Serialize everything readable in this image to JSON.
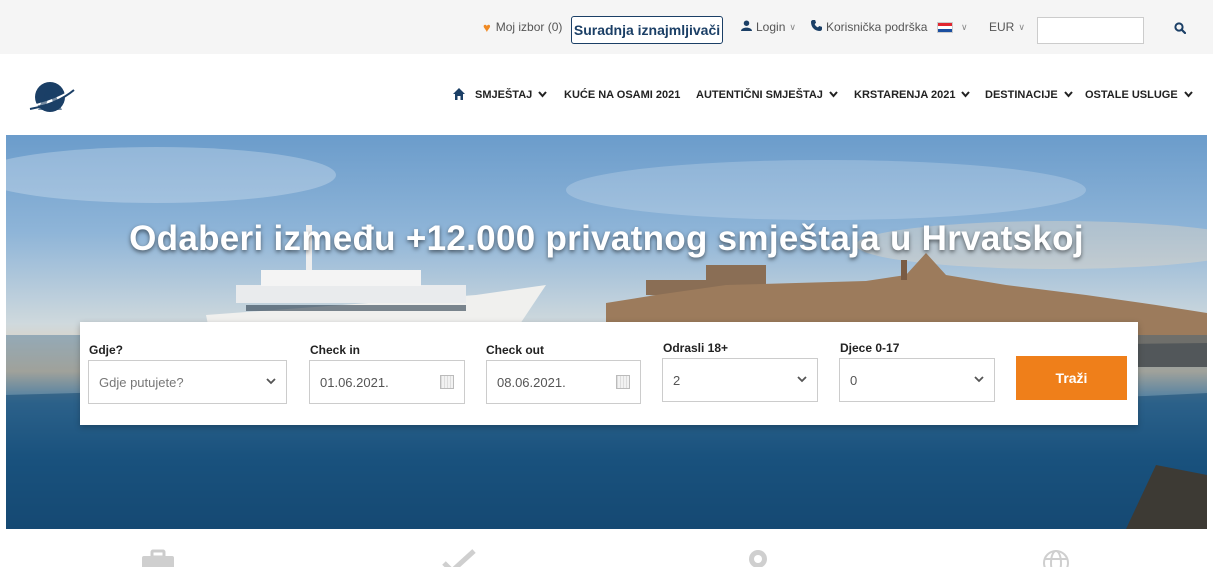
{
  "topbar": {
    "favorites_label": "Moj izbor (0)",
    "partner_label": "Suradnja iznajmljivači",
    "login_label": "Login",
    "support_label": "Korisnička podrška",
    "currency_label": "EUR",
    "search_placeholder": ""
  },
  "nav": {
    "items": [
      {
        "label": "SMJEŠTAJ",
        "dropdown": true
      },
      {
        "label": "KUĆE NA OSAMI 2021",
        "dropdown": false
      },
      {
        "label": "AUTENTIČNI SMJEŠTAJ",
        "dropdown": true
      },
      {
        "label": "KRSTARENJA 2021",
        "dropdown": true
      },
      {
        "label": "DESTINACIJE",
        "dropdown": true
      },
      {
        "label": "OSTALE USLUGE",
        "dropdown": true
      }
    ]
  },
  "hero": {
    "title": "Odaberi između +12.000 privatnog smještaja u Hrvatskoj"
  },
  "search": {
    "where_label": "Gdje?",
    "where_placeholder": "Gdje putujete?",
    "checkin_label": "Check in",
    "checkin_value": "01.06.2021.",
    "checkout_label": "Check out",
    "checkout_value": "08.06.2021.",
    "adults_label": "Odrasli 18+",
    "adults_value": "2",
    "children_label": "Djece 0-17",
    "children_value": "0",
    "submit_label": "Traži"
  },
  "features": [
    "suitcase-icon",
    "checkmark-icon",
    "location-pin-icon",
    "globe-icon"
  ],
  "colors": {
    "accent": "#ef7f1a",
    "brand": "#1b3f66",
    "heart": "#f08a24"
  }
}
